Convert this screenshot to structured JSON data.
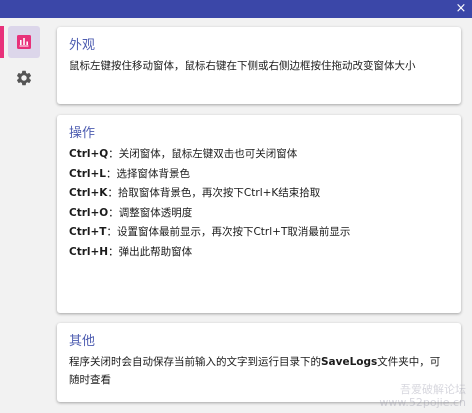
{
  "titlebar": {
    "close_glyph": "×",
    "color": "#3b47a8"
  },
  "sidebar": {
    "items": [
      {
        "icon": "chart-icon",
        "active": true
      },
      {
        "icon": "gear-icon",
        "active": false
      }
    ],
    "accent_color": "#e8317a"
  },
  "appearance": {
    "title": "外观",
    "text": "鼠标左键按住移动窗体，鼠标右键在下侧或右侧边框按住拖动改变窗体大小"
  },
  "operations": {
    "title": "操作",
    "shortcuts": [
      {
        "key": "Ctrl+Q",
        "desc": "：关闭窗体，鼠标左键双击也可关闭窗体"
      },
      {
        "key": "Ctrl+L",
        "desc": "：选择窗体背景色"
      },
      {
        "key": "Ctrl+K",
        "desc": "：拾取窗体背景色，再次按下Ctrl+K结束拾取"
      },
      {
        "key": "Ctrl+O",
        "desc": "：调整窗体透明度"
      },
      {
        "key": "Ctrl+T",
        "desc": "：设置窗体最前显示，再次按下Ctrl+T取消最前显示"
      },
      {
        "key": "Ctrl+H",
        "desc": "：弹出此帮助窗体"
      }
    ]
  },
  "other": {
    "title": "其他",
    "text_before": "程序关闭时会自动保存当前输入的文字到运行目录下的",
    "text_bold": "SaveLogs",
    "text_after": "文件夹中，可随时查看"
  },
  "watermark": {
    "line1": "吾爱破解论坛",
    "line2": "www.52pojie.cn"
  },
  "colors": {
    "accent": "#e8317a",
    "title_blue": "#4d5cb0",
    "active_bg": "#dcd6ea"
  }
}
